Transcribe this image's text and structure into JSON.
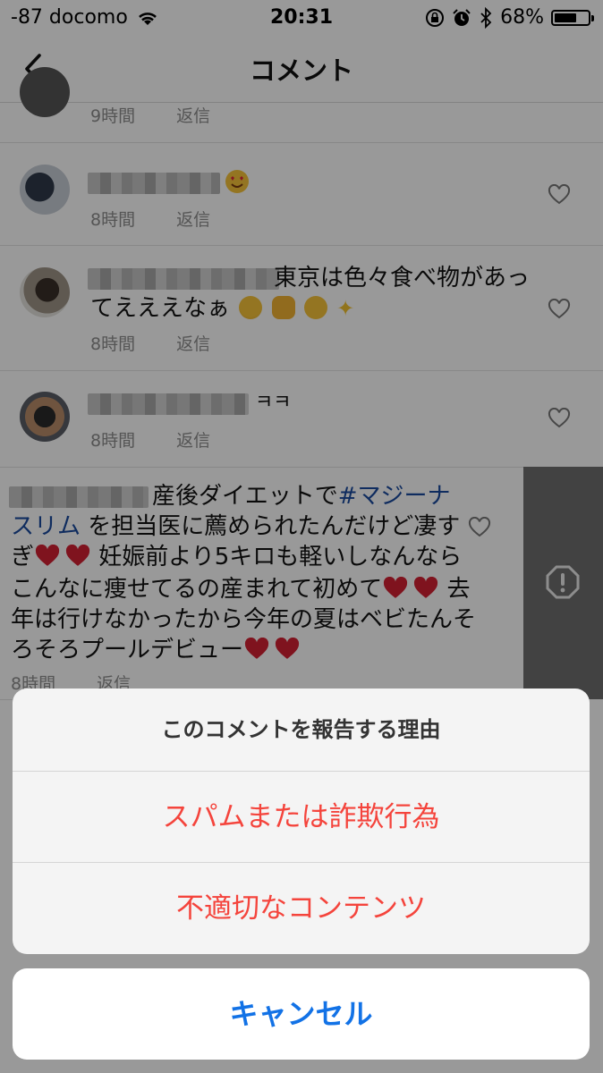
{
  "status_bar": {
    "carrier": "-87 docomo",
    "time": "20:31",
    "battery": "68%",
    "battery_level": 0.68
  },
  "nav": {
    "title": "コメント"
  },
  "comments": [
    {
      "time": "9時間",
      "reply": "返信"
    },
    {
      "time": "8時間",
      "reply": "返信"
    },
    {
      "text_line1": "東京は色々食べ物があっ",
      "text_line2": "てえええなぁ",
      "time": "8時間",
      "reply": "返信"
    },
    {
      "text": "ㅋㅋ",
      "time": "8時間",
      "reply": "返信"
    },
    {
      "text_start": "産後ダイエットで",
      "hashtag": "#マジーナスリム",
      "line2_rest": "を担当医に薦められたんだけど凄す",
      "line3_start": "ぎ",
      "line3_rest": "妊娠前より5キロも軽いしなんなら",
      "line4": "こんなに痩せてるの産まれて初めて",
      "line4_end": "去",
      "line5": "年は行けなかったから今年の夏はベビたんそ",
      "line6": "ろそろプールデビュー",
      "time": "8時間",
      "reply": "返信"
    }
  ],
  "action_sheet": {
    "title": "このコメントを報告する理由",
    "options": [
      "スパムまたは詐欺行為",
      "不適切なコンテンツ"
    ],
    "cancel": "キャンセル"
  },
  "colors": {
    "destructive": "#f4443c",
    "cancel": "#1272e6",
    "hashtag": "#1a4a9e"
  },
  "icons": [
    "back-chevron-icon",
    "wifi-icon",
    "rotation-lock-icon",
    "alarm-icon",
    "bluetooth-icon",
    "battery-icon",
    "heart-icon",
    "report-alert-icon"
  ]
}
